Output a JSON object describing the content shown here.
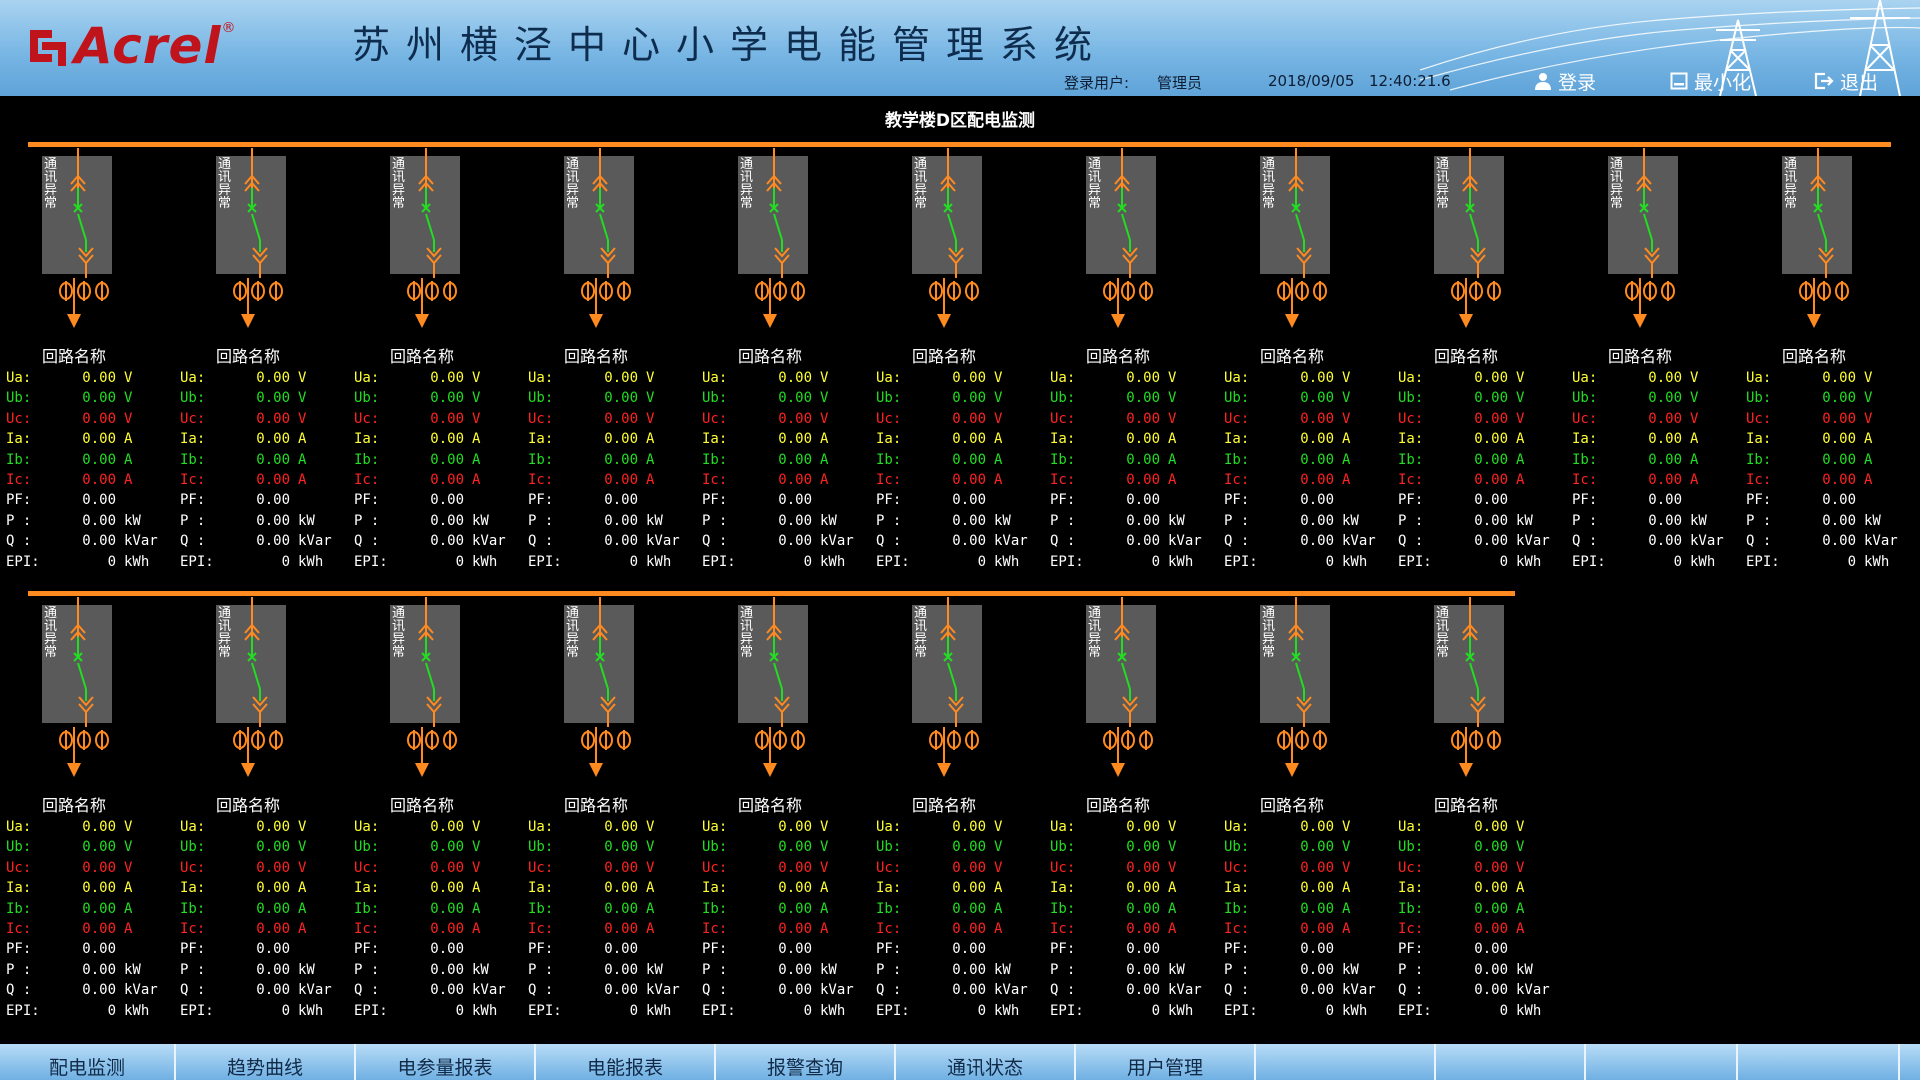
{
  "header": {
    "logo_text": "Acrel",
    "logo_reg": "®",
    "title": "苏州横泾中心小学电能管理系统",
    "user_label": "登录用户:",
    "user_name": "管理员",
    "date": "2018/09/05",
    "time": "12:40:21.6",
    "login_label": "登录",
    "minimize_label": "最小化",
    "exit_label": "退出"
  },
  "panel": {
    "title": "教学楼D区配电监测",
    "comm_status": "通讯异常",
    "circuit_name": "回路名称",
    "rows": [
      {
        "label": "Ua:",
        "value": "0.00",
        "unit": "V",
        "color": "#ffff33"
      },
      {
        "label": "Ub:",
        "value": "0.00",
        "unit": "V",
        "color": "#22dd22"
      },
      {
        "label": "Uc:",
        "value": "0.00",
        "unit": "V",
        "color": "#ff2222"
      },
      {
        "label": "Ia:",
        "value": "0.00",
        "unit": "A",
        "color": "#ffff33"
      },
      {
        "label": "Ib:",
        "value": "0.00",
        "unit": "A",
        "color": "#22dd22"
      },
      {
        "label": "Ic:",
        "value": "0.00",
        "unit": "A",
        "color": "#ff2222"
      },
      {
        "label": "PF:",
        "value": "0.00",
        "unit": "",
        "color": "#ffffff"
      },
      {
        "label": "P :",
        "value": "0.00",
        "unit": "kW",
        "color": "#ffffff"
      },
      {
        "label": "Q :",
        "value": "0.00",
        "unit": "kVar",
        "color": "#ffffff"
      },
      {
        "label": "EPI:",
        "value": "0",
        "unit": "kWh",
        "color": "#ffffff"
      }
    ],
    "row1_count": 11,
    "row2_count": 9
  },
  "nav": {
    "items": [
      "配电监测",
      "趋势曲线",
      "电参量报表",
      "电能报表",
      "报警查询",
      "通讯状态",
      "用户管理",
      "",
      "",
      "",
      ""
    ]
  },
  "colors": {
    "bus": "#ff8a1f",
    "cabinet": "#5a5a5a",
    "breaker": "#22dd22",
    "header_bg": "#75b4e3"
  }
}
